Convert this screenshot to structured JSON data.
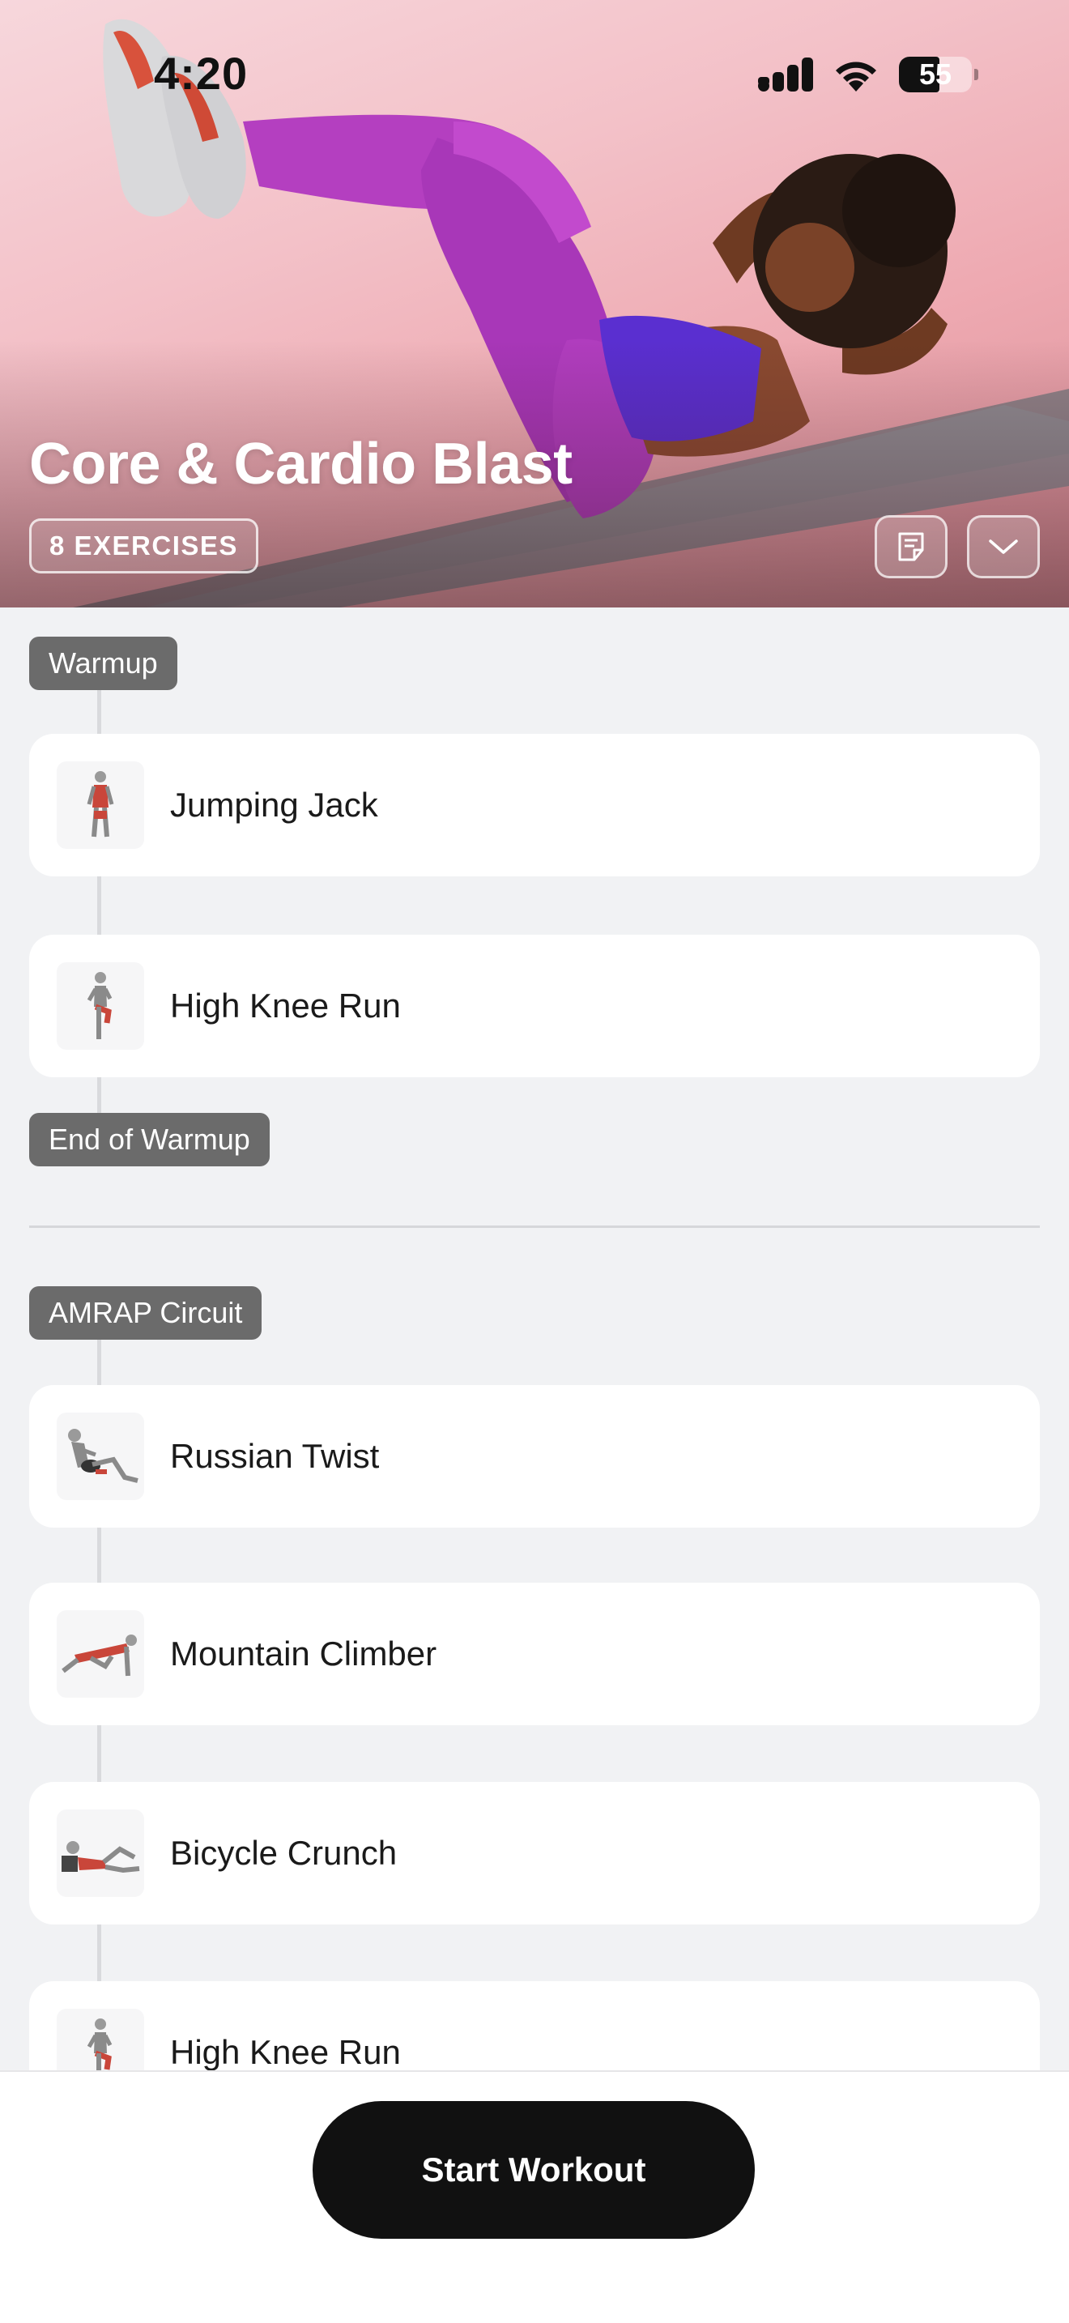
{
  "status_bar": {
    "time": "4:20",
    "battery": "55"
  },
  "hero": {
    "title": "Core & Cardio Blast",
    "exercise_count": "8 EXERCISES"
  },
  "groups": {
    "warmup_label": "Warmup",
    "warmup_end_label": "End of Warmup",
    "circuit_label": "AMRAP Circuit"
  },
  "exercises": [
    {
      "name": "Jumping Jack",
      "icon": "jumping-jack-figure"
    },
    {
      "name": "High Knee Run",
      "icon": "high-knee-run-figure"
    },
    {
      "name": "Russian Twist",
      "icon": "russian-twist-figure"
    },
    {
      "name": "Mountain Climber",
      "icon": "mountain-climber-figure"
    },
    {
      "name": "Bicycle Crunch",
      "icon": "bicycle-crunch-figure"
    },
    {
      "name": "High Knee Run",
      "icon": "high-knee-run-figure"
    }
  ],
  "footer": {
    "start_label": "Start Workout"
  },
  "colors": {
    "background": "#f1f2f4",
    "group_label_bg": "#6b6b6b",
    "start_button_bg": "#111111",
    "hero_gradient": "#f3c1c8"
  }
}
